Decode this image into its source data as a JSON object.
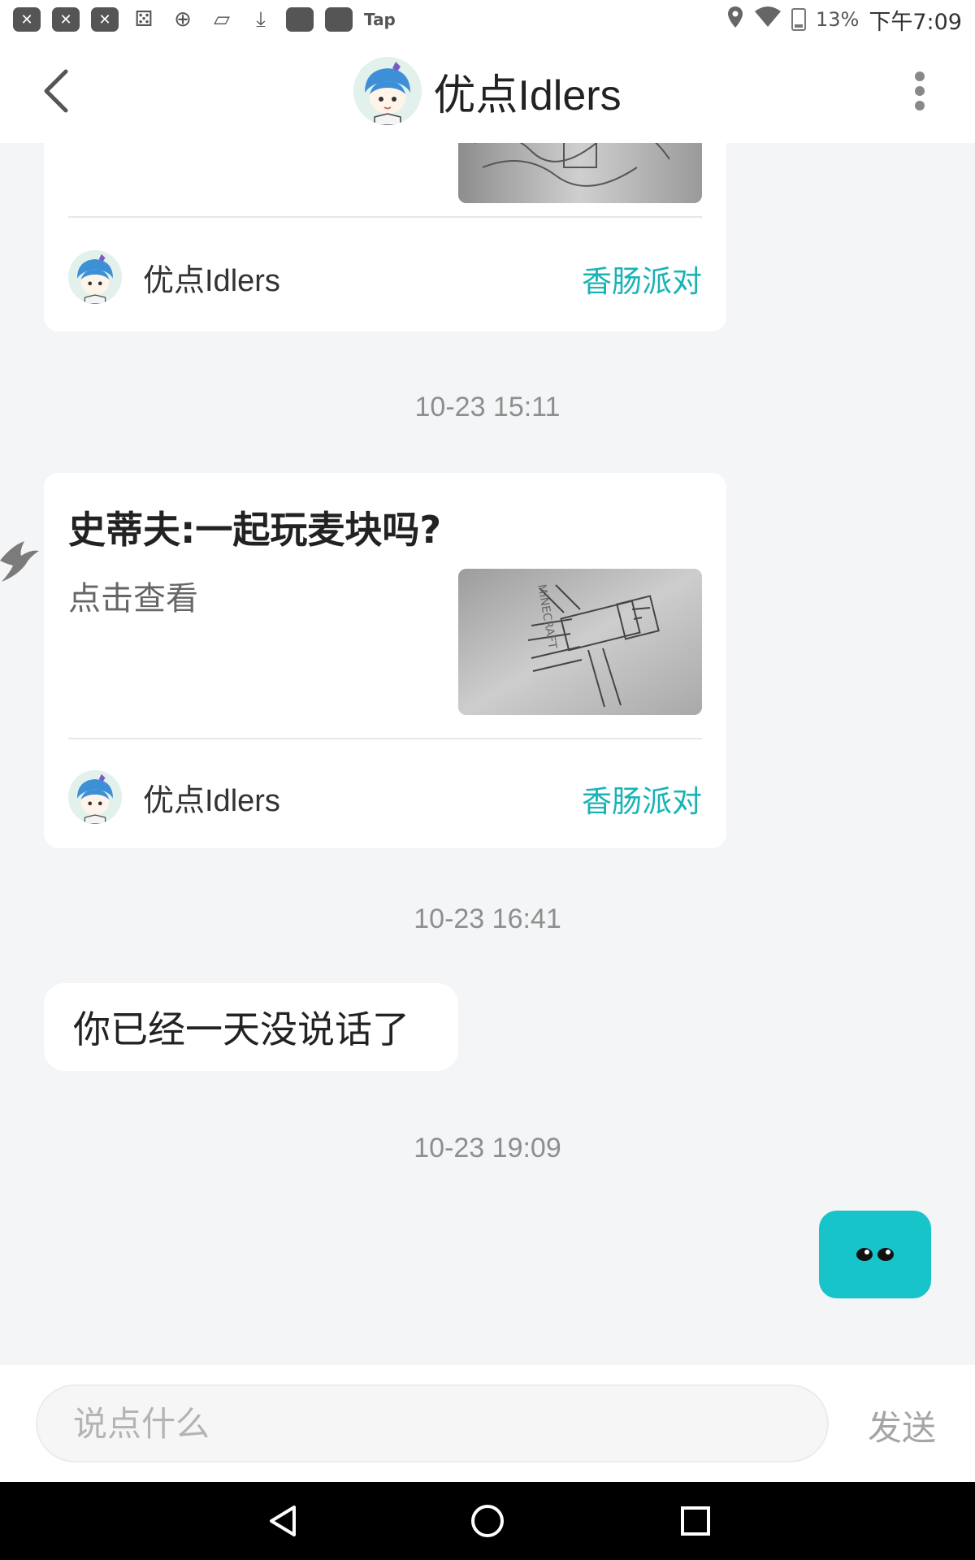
{
  "status_bar": {
    "tap_label": "Tap",
    "battery": "13%",
    "time": "下午7:09"
  },
  "header": {
    "title": "优点Idlers"
  },
  "messages": {
    "card1": {
      "author": "优点Idlers",
      "group": "香肠派对"
    },
    "time1": "10-23 15:11",
    "card2": {
      "title": "史蒂夫:一起玩麦块吗?",
      "subtitle": "点击查看",
      "author": "优点Idlers",
      "group": "香肠派对"
    },
    "time2": "10-23 16:41",
    "bubble_text": "你已经一天没说话了",
    "time3": "10-23 19:09"
  },
  "input_bar": {
    "placeholder": "说点什么",
    "send_label": "发送"
  },
  "colors": {
    "accent": "#17b3b6",
    "float_button": "#17c4c9",
    "background": "#f4f5f7"
  }
}
